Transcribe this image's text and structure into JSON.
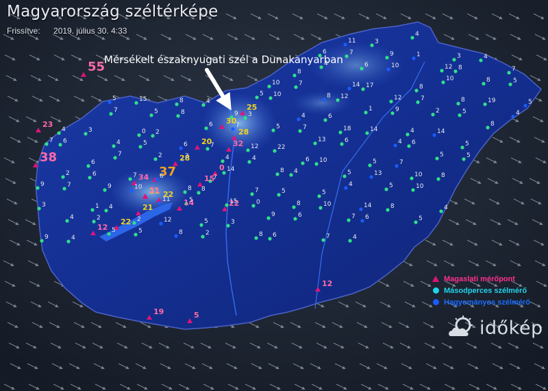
{
  "title": "Magyarország széltérképe",
  "updated": {
    "label": "Frissítve:",
    "value": "2019. július 30. 4:33"
  },
  "annotation": {
    "text": "Mérsékelt északnyugati szél a Dunakanyarban"
  },
  "legend": [
    {
      "label": "Magaslati mérőpont",
      "color": "#e0137a",
      "shape": "triangle"
    },
    {
      "label": "Másodperces szélmérő",
      "color": "#22d3e8",
      "shape": "circle"
    },
    {
      "label": "Hagyományos szélmérő",
      "color": "#1a5cff",
      "shape": "circle"
    }
  ],
  "logo": {
    "text": "időkép",
    "icon": "cloud-sun-icon"
  },
  "highlight_labels": [
    {
      "v": "55",
      "c": "#ff6aa8"
    },
    {
      "v": "38",
      "c": "#ff6aa8"
    },
    {
      "v": "32",
      "c": "#ff6aa8"
    },
    {
      "v": "34",
      "c": "#ff6aa8"
    },
    {
      "v": "23",
      "c": "#ff6aa8"
    },
    {
      "v": "30",
      "c": "#f3d21c"
    },
    {
      "v": "37",
      "c": "#f3a21c"
    },
    {
      "v": "28",
      "c": "#f3d21c"
    },
    {
      "v": "28",
      "c": "#f3d21c"
    },
    {
      "v": "25",
      "c": "#f3d21c"
    },
    {
      "v": "22",
      "c": "#f3d21c"
    },
    {
      "v": "22",
      "c": "#f3d21c"
    },
    {
      "v": "21",
      "c": "#f3d21c"
    },
    {
      "v": "21",
      "c": "#f3d21c"
    },
    {
      "v": "20",
      "c": "#f3d21c"
    },
    {
      "v": "22",
      "c": "#ff6aa8"
    },
    {
      "v": "21",
      "c": "#ff6aa8"
    },
    {
      "v": "15",
      "c": "#ff6aa8"
    },
    {
      "v": "14",
      "c": "#ff6aa8"
    },
    {
      "v": "12",
      "c": "#ff6aa8"
    },
    {
      "v": "12",
      "c": "#ff6aa8"
    },
    {
      "v": "19",
      "c": "#ff6aa8"
    },
    {
      "v": "5",
      "c": "#ff6aa8"
    },
    {
      "v": "0",
      "c": "#ff6aa8"
    }
  ],
  "station_labels": [
    "11",
    "3",
    "4",
    "6",
    "7",
    "9",
    "1",
    "3",
    "4",
    "8",
    "4",
    "6",
    "10",
    "12",
    "8",
    "7",
    "10",
    "7",
    "14",
    "17",
    "8",
    "10",
    "8",
    "5",
    "5",
    "15",
    "8",
    "4",
    "5",
    "10",
    "8",
    "12",
    "12",
    "7",
    "8",
    "19",
    "5",
    "7",
    "5",
    "8",
    "9",
    "3",
    "4",
    "6",
    "1",
    "9",
    "2",
    "5",
    "4",
    "4",
    "3",
    "0",
    "2",
    "6",
    "7",
    "5",
    "7",
    "18",
    "14",
    "4",
    "14",
    "8",
    "7",
    "6",
    "4",
    "5",
    "6",
    "7",
    "12",
    "22",
    "13",
    "6",
    "4",
    "6",
    "5",
    "6",
    "7",
    "2",
    "3",
    "4",
    "4",
    "6",
    "10",
    "5",
    "7",
    "5",
    "5",
    "2",
    "6",
    "7",
    "6",
    "7",
    "14",
    "8",
    "4",
    "5",
    "13",
    "10",
    "8",
    "9",
    "7",
    "9",
    "10",
    "8",
    "8",
    "7",
    "5",
    "5",
    "4",
    "5",
    "10",
    "3",
    "1",
    "4",
    "11",
    "5",
    "15",
    "0",
    "8",
    "10",
    "14",
    "8",
    "4",
    "4",
    "2",
    "2",
    "12",
    "5",
    "3",
    "9",
    "6",
    "7",
    "6",
    "5",
    "9",
    "4",
    "5",
    "5",
    "8",
    "2",
    "8",
    "6",
    "7",
    "4"
  ]
}
